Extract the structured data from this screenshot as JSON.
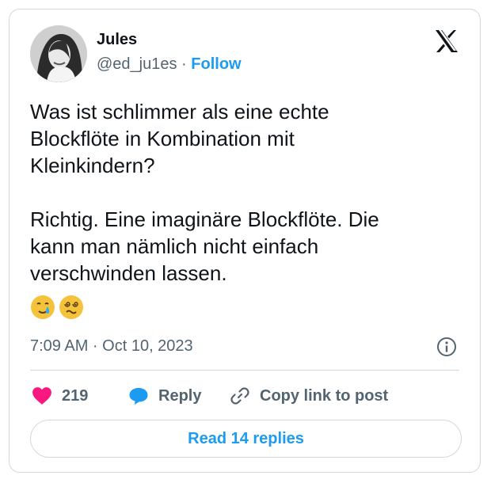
{
  "author": {
    "name": "Jules",
    "handle": "@ed_ju1es",
    "separator": "·",
    "follow_label": "Follow"
  },
  "tweet": {
    "text": "Was ist schlimmer als eine echte\nBlockflöte in Kombination mit\nKleinkindern?\n\nRichtig. Eine imaginäre Blockflöte. Die\nkann man nämlich nicht einfach\nverschwinden lassen.",
    "emojis": [
      "smiling-face-with-tear",
      "face-with-spiral-eyes"
    ],
    "timestamp": "7:09 AM · Oct 10, 2023"
  },
  "actions": {
    "like_count": "219",
    "reply_label": "Reply",
    "copy_label": "Copy link to post"
  },
  "footer": {
    "read_replies_label": "Read 14 replies"
  },
  "icons": {
    "brand": "x-logo-icon",
    "info": "info-icon",
    "like": "heart-icon",
    "reply": "speech-bubble-icon",
    "copy": "link-icon"
  },
  "colors": {
    "accent": "#1d9bf0",
    "like": "#f91880",
    "muted": "#536471",
    "border": "#cfd9de"
  }
}
